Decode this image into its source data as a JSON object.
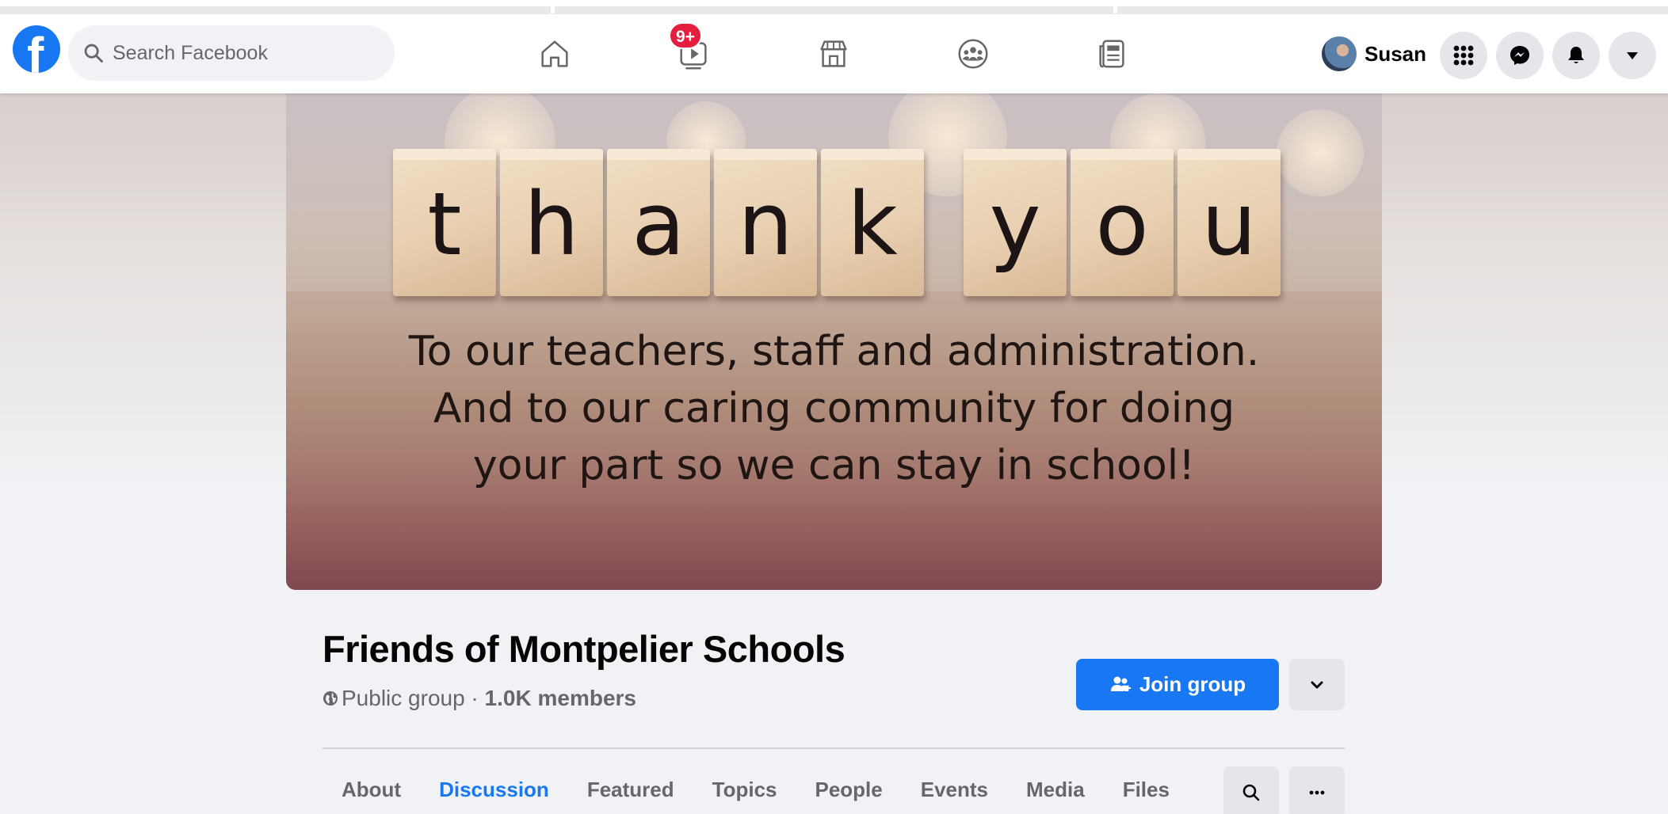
{
  "search": {
    "placeholder": "Search Facebook"
  },
  "nav": {
    "watch_badge": "9+",
    "icons": [
      "home-icon",
      "watch-icon",
      "marketplace-icon",
      "groups-icon",
      "news-icon"
    ]
  },
  "profile": {
    "name": "Susan"
  },
  "cover": {
    "tile_letters": [
      "t",
      "h",
      "a",
      "n",
      "k",
      "y",
      "o",
      "u"
    ],
    "lines": [
      "To our teachers, staff and administration.",
      "And to our caring community for doing",
      "your part so we can stay in school!"
    ]
  },
  "group": {
    "name": "Friends of Montpelier Schools",
    "privacy": "Public group",
    "separator": " · ",
    "members": "1.0K members",
    "join_label": "Join group"
  },
  "tabs": [
    {
      "label": "About"
    },
    {
      "label": "Discussion",
      "active": true
    },
    {
      "label": "Featured"
    },
    {
      "label": "Topics"
    },
    {
      "label": "People"
    },
    {
      "label": "Events"
    },
    {
      "label": "Media"
    },
    {
      "label": "Files"
    }
  ],
  "colors": {
    "brand": "#1877f2",
    "badge": "#e41e3f",
    "text_secondary": "#65676b",
    "button_gray": "#e4e6eb"
  }
}
